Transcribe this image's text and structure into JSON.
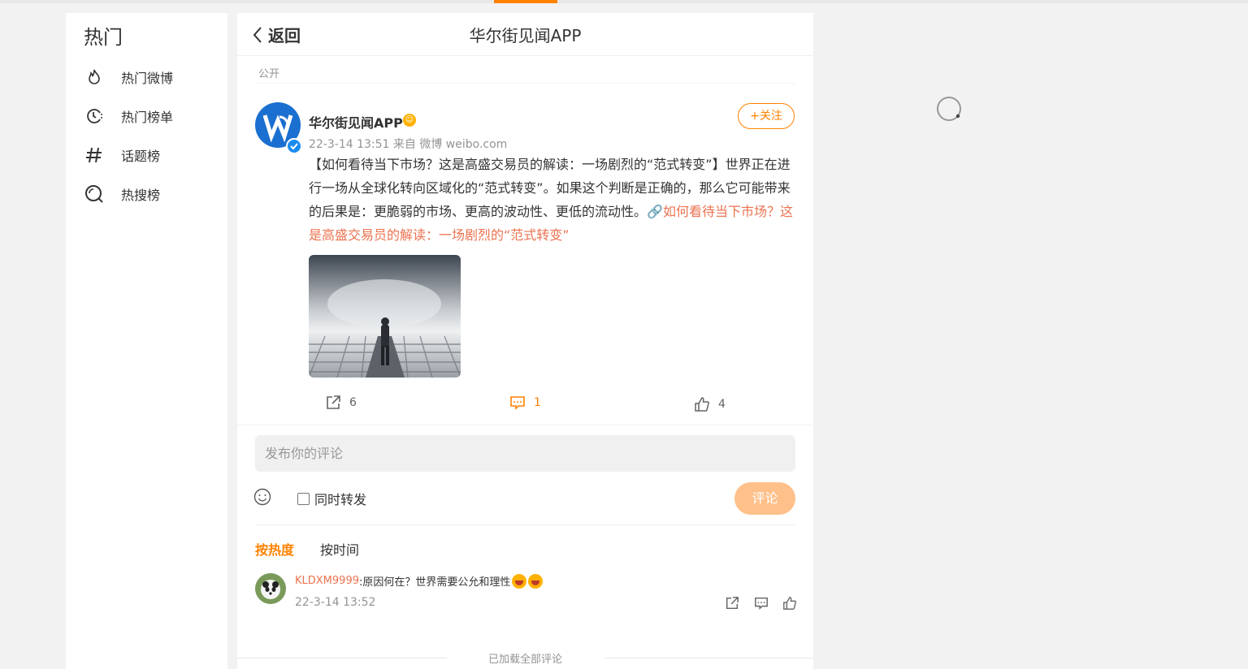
{
  "sidebar": {
    "title": "热门",
    "items": [
      {
        "label": "热门微博",
        "icon": "flame-icon"
      },
      {
        "label": "热门榜单",
        "icon": "clock-list-icon"
      },
      {
        "label": "话题榜",
        "icon": "hashtag-icon"
      },
      {
        "label": "热搜榜",
        "icon": "search-ring-icon"
      }
    ]
  },
  "header": {
    "back_label": "返回",
    "title": "华尔街见闻APP"
  },
  "post": {
    "visibility": "公开",
    "author": "华尔街见闻APP",
    "meta": "22-3-14 13:51 来自 微博 weibo.com",
    "follow_label": "+关注",
    "text": "【如何看待当下市场？这是高盛交易员的解读：一场剧烈的“范式转变”】世界正在进行一场从全球化转向区域化的“范式转变”。如果这个判断是正确的，那么它可能带来的后果是：更脆弱的市场、更高的波动性、更低的流动性。",
    "link_text": "🔗如何看待当下市场？这是高盛交易员的解读：一场剧烈的“范式转变”",
    "repost_count": "6",
    "comment_count": "1",
    "like_count": "4"
  },
  "composer": {
    "placeholder": "发布你的评论",
    "repost_label": "同时转发",
    "submit_label": "评论"
  },
  "sort": {
    "hot_label": "按热度",
    "time_label": "按时间"
  },
  "comments": [
    {
      "user": "KLDXM9999",
      "text": ":原因何在？世界需要公允和理性",
      "time": "22-3-14 13:52"
    }
  ],
  "footer": {
    "all_loaded": "已加载全部评论"
  },
  "colors": {
    "accent": "#ff8200",
    "link": "#eb7350",
    "muted": "#939393",
    "background": "#f2f2f2"
  }
}
